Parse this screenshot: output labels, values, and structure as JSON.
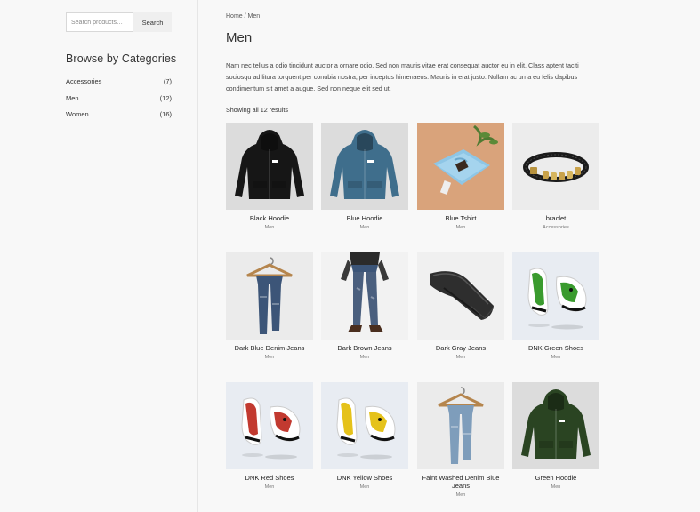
{
  "search": {
    "placeholder": "Search products…",
    "button_label": "Search"
  },
  "sidebar": {
    "heading": "Browse by Categories",
    "categories": [
      {
        "name": "Accessories",
        "count": "(7)"
      },
      {
        "name": "Men",
        "count": "(12)"
      },
      {
        "name": "Women",
        "count": "(16)"
      }
    ]
  },
  "breadcrumb": {
    "home": "Home",
    "separator": " / ",
    "current": "Men"
  },
  "page": {
    "title": "Men",
    "description": "Nam nec tellus a odio tincidunt auctor a ornare odio. Sed non mauris vitae erat consequat auctor eu in elit. Class aptent taciti sociosqu ad litora torquent per conubia nostra, per inceptos himenaeos. Mauris in erat justo. Nullam ac urna eu felis dapibus condimentum sit amet a augue. Sed non neque elit sed ut.",
    "result_count": "Showing all 12 results"
  },
  "products": [
    {
      "title": "Black Hoodie",
      "category": "Men",
      "image": "hoodie-black"
    },
    {
      "title": "Blue Hoodie",
      "category": "Men",
      "image": "hoodie-blue"
    },
    {
      "title": "Blue Tshirt",
      "category": "Men",
      "image": "tshirt-folded"
    },
    {
      "title": "braclet",
      "category": "Accessories",
      "image": "bracelet"
    },
    {
      "title": "Dark Blue Denim Jeans",
      "category": "Men",
      "image": "jeans-hanger"
    },
    {
      "title": "Dark Brown Jeans",
      "category": "Men",
      "image": "jeans-worn"
    },
    {
      "title": "Dark Gray Jeans",
      "category": "Men",
      "image": "jeans-folded"
    },
    {
      "title": "DNK Green Shoes",
      "category": "Men",
      "image": "shoes-green"
    },
    {
      "title": "DNK Red Shoes",
      "category": "Men",
      "image": "shoes-red"
    },
    {
      "title": "DNK Yellow Shoes",
      "category": "Men",
      "image": "shoes-yellow"
    },
    {
      "title": "Faint Washed Denim Blue Jeans",
      "category": "Men",
      "image": "jeans-hanger-light"
    },
    {
      "title": "Green Hoodie",
      "category": "Men",
      "image": "hoodie-green"
    }
  ],
  "colors": {
    "hoodie_black": "#161616",
    "hoodie_blue": "#3f6e8c",
    "hoodie_green": "#2a4422",
    "tshirt_bg": "#d9a37b",
    "tshirt": "#8ec6e6",
    "denim_dark": "#3c5578",
    "denim_light": "#7e9dbb",
    "shoe_green": "#3a9b2e",
    "shoe_red": "#c23a30",
    "shoe_yellow": "#e5c21a"
  }
}
